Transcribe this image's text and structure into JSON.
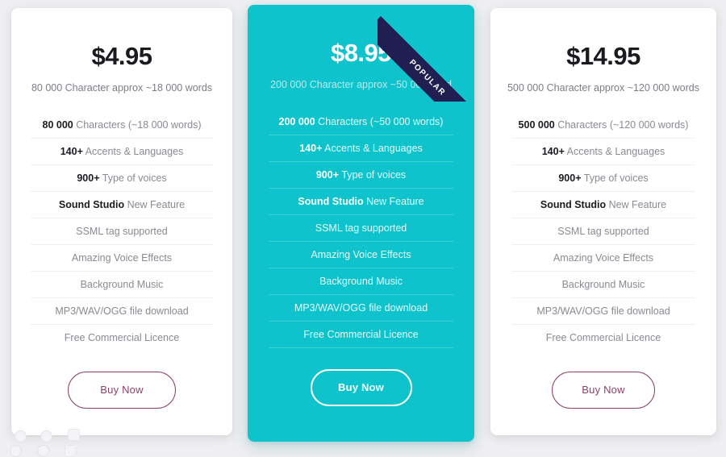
{
  "page": {
    "background_color": "#efeff1",
    "accent_teal": "#0ec3cc",
    "accent_purple": "#8e3f6b",
    "ribbon_color": "#211f52"
  },
  "plans": [
    {
      "id": "starter",
      "price": "$4.95",
      "price_sub": "80 000 Character approx ~18 000 words",
      "badge": null,
      "features": [
        {
          "strong": "80 000",
          "rest": " Characters (~18 000 words)"
        },
        {
          "strong": "140+",
          "rest": " Accents & Languages"
        },
        {
          "strong": "900+",
          "rest": " Type of voices"
        },
        {
          "strong": "Sound Studio",
          "rest": " New Feature"
        },
        {
          "strong": "",
          "rest": "SSML tag supported"
        },
        {
          "strong": "",
          "rest": "Amazing Voice Effects"
        },
        {
          "strong": "",
          "rest": "Background Music"
        },
        {
          "strong": "",
          "rest": "MP3/WAV/OGG file download"
        },
        {
          "strong": "",
          "rest": "Free Commercial Licence"
        }
      ],
      "cta_label": "Buy Now"
    },
    {
      "id": "popular",
      "price": "$8.95",
      "price_sub": "200 000 Character approx ~50 000 word",
      "badge": "POPULAR",
      "features": [
        {
          "strong": "200 000",
          "rest": " Characters (~50 000 words)"
        },
        {
          "strong": "140+",
          "rest": " Accents & Languages"
        },
        {
          "strong": "900+",
          "rest": " Type of voices"
        },
        {
          "strong": "Sound Studio",
          "rest": " New Feature"
        },
        {
          "strong": "",
          "rest": "SSML tag supported"
        },
        {
          "strong": "",
          "rest": "Amazing Voice Effects"
        },
        {
          "strong": "",
          "rest": "Background Music"
        },
        {
          "strong": "",
          "rest": "MP3/WAV/OGG file download"
        },
        {
          "strong": "",
          "rest": "Free Commercial Licence"
        }
      ],
      "cta_label": "Buy Now"
    },
    {
      "id": "pro",
      "price": "$14.95",
      "price_sub": "500 000 Character approx ~120 000 words",
      "badge": null,
      "features": [
        {
          "strong": "500 000",
          "rest": " Characters (~120 000 words)"
        },
        {
          "strong": "140+",
          "rest": " Accents & Languages"
        },
        {
          "strong": "900+",
          "rest": " Type of voices"
        },
        {
          "strong": "Sound Studio",
          "rest": " New Feature"
        },
        {
          "strong": "",
          "rest": "SSML tag supported"
        },
        {
          "strong": "",
          "rest": "Amazing Voice Effects"
        },
        {
          "strong": "",
          "rest": "Background Music"
        },
        {
          "strong": "",
          "rest": "MP3/WAV/OGG file download"
        },
        {
          "strong": "",
          "rest": "Free Commercial Licence"
        }
      ],
      "cta_label": "Buy Now"
    }
  ],
  "overlay_icons": [
    "circle-icon",
    "circle-icon",
    "rounded-square-icon",
    "circle-icon",
    "circle-icon",
    "rounded-square-icon"
  ]
}
